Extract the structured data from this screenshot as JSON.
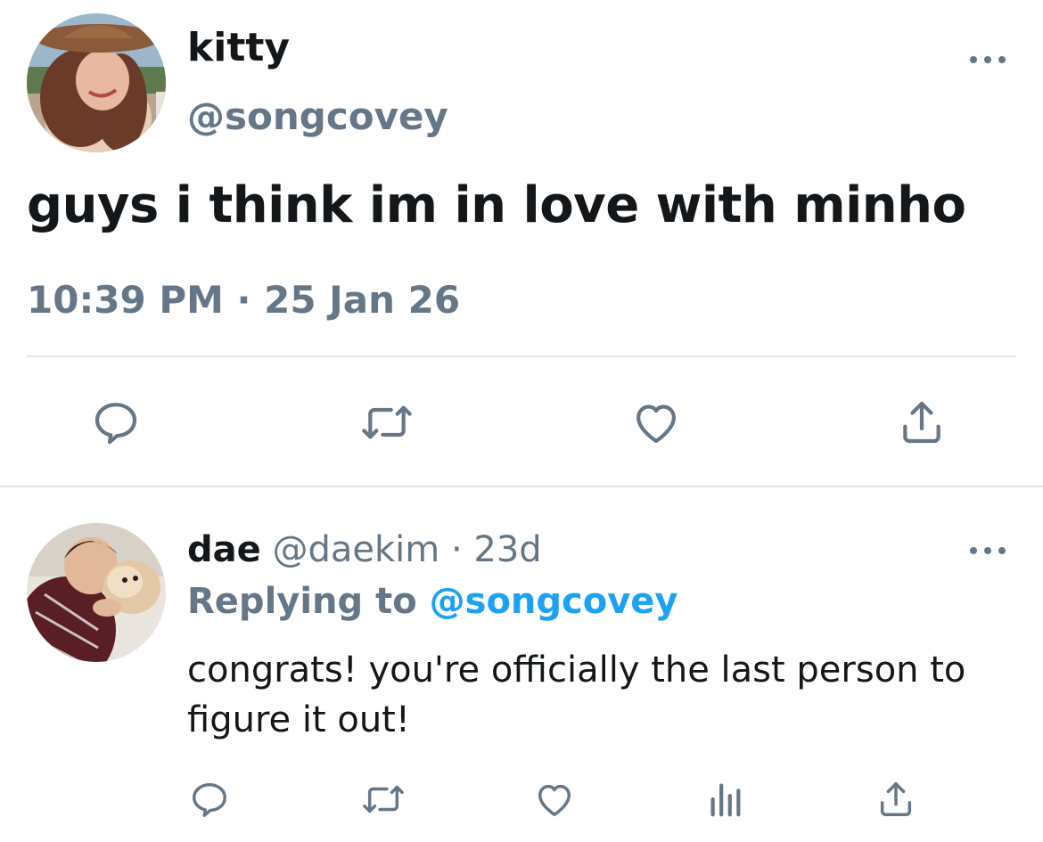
{
  "tweet": {
    "author_name": "kitty",
    "author_handle": "@songcovey",
    "text": "guys i think im in love with minho",
    "timestamp": "10:39 PM · 25 Jan 26",
    "actions": [
      "reply-icon",
      "retweet-icon",
      "like-icon",
      "share-icon"
    ]
  },
  "reply": {
    "author_name": "dae",
    "author_handle": "@daekim",
    "separator": "·",
    "age": "23d",
    "replying_label": "Replying to",
    "replying_handle": "@songcovey",
    "text": "congrats! you're officially the last person to figure it out!",
    "actions": [
      "reply-icon",
      "retweet-icon",
      "like-icon",
      "analytics-icon",
      "share-icon"
    ]
  },
  "colors": {
    "text": "#14171a",
    "secondary": "#657786",
    "link": "#1da1f2",
    "divider": "#e1e8ed"
  }
}
